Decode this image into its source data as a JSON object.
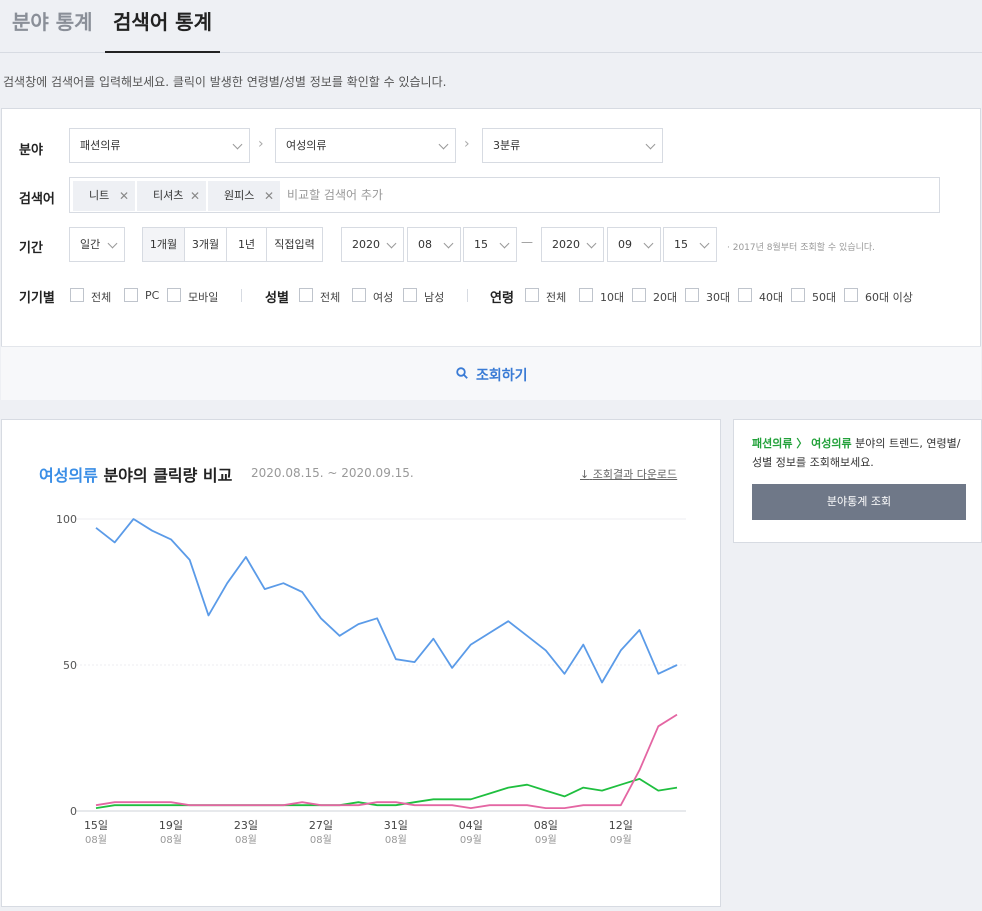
{
  "tabs": {
    "field": "분야 통계",
    "keyword": "검색어 통계"
  },
  "help_text": "검색창에 검색어를 입력해보세요. 클릭이 발생한 연령별/성별 정보를 확인할 수 있습니다.",
  "filters": {
    "category_label": "분야",
    "cat1": "패션의류",
    "cat2": "여성의류",
    "cat3": "3분류",
    "keyword_label": "검색어",
    "keywords": [
      "니트",
      "티셔츠",
      "원피스"
    ],
    "keyword_placeholder": "비교할 검색어 추가",
    "period_label": "기간",
    "granularity": "일간",
    "ranges": [
      "1개월",
      "3개월",
      "1년",
      "직접입력"
    ],
    "start": {
      "year": "2020",
      "month": "08",
      "day": "15"
    },
    "end": {
      "year": "2020",
      "month": "09",
      "day": "15"
    },
    "date_note": "· 2017년 8월부터 조회할 수 있습니다.",
    "device_label": "기기별",
    "devices": [
      "전체",
      "PC",
      "모바일"
    ],
    "gender_label": "성별",
    "genders": [
      "전체",
      "여성",
      "남성"
    ],
    "age_label": "연령",
    "ages": [
      "전체",
      "10대",
      "20대",
      "30대",
      "40대",
      "50대",
      "60대 이상"
    ],
    "range_dash": "—",
    "search_button": "조회하기"
  },
  "chart_header": {
    "title_accent": "여성의류",
    "title_rest": " 분야의 클릭량 비교",
    "range": "2020.08.15. ~ 2020.09.15.",
    "download": "조회결과 다운로드"
  },
  "side_panel": {
    "path_cat1": "패션의류",
    "path_sep": " 〉 ",
    "path_cat2": "여성의류",
    "text_rest": " 분야의 트렌드, 연령별/성별 정보를 조회해보세요.",
    "button": "분야통계 조회"
  },
  "colors": {
    "accent": "#3a8ee6",
    "green": "#22a13a",
    "blue_series": "#5b9be8",
    "green_series": "#1fbf3f",
    "pink_series": "#e466a3"
  },
  "chart_data": {
    "type": "line",
    "ylim": [
      0,
      100
    ],
    "yticks": [
      "100",
      "50",
      "0"
    ],
    "xticks": [
      {
        "day": "15일",
        "month": "08월"
      },
      {
        "day": "19일",
        "month": "08월"
      },
      {
        "day": "23일",
        "month": "08월"
      },
      {
        "day": "27일",
        "month": "08월"
      },
      {
        "day": "31일",
        "month": "08월"
      },
      {
        "day": "04일",
        "month": "09월"
      },
      {
        "day": "08일",
        "month": "09월"
      },
      {
        "day": "12일",
        "month": "09월"
      }
    ],
    "series": [
      {
        "color": "#5b9be8",
        "values": [
          97,
          92,
          100,
          96,
          93,
          86,
          67,
          78,
          87,
          76,
          78,
          75,
          66,
          60,
          64,
          66,
          52,
          51,
          59,
          49,
          57,
          61,
          65,
          60,
          55,
          47,
          57,
          44,
          55,
          62,
          47,
          50
        ]
      },
      {
        "color": "#1fbf3f",
        "values": [
          1,
          2,
          2,
          2,
          2,
          2,
          2,
          2,
          2,
          2,
          2,
          2,
          2,
          2,
          3,
          2,
          2,
          3,
          4,
          4,
          4,
          6,
          8,
          9,
          7,
          5,
          8,
          7,
          9,
          11,
          7,
          8
        ]
      },
      {
        "color": "#e466a3",
        "values": [
          2,
          3,
          3,
          3,
          3,
          2,
          2,
          2,
          2,
          2,
          2,
          3,
          2,
          2,
          2,
          3,
          3,
          2,
          2,
          2,
          1,
          2,
          2,
          2,
          1,
          1,
          2,
          2,
          2,
          14,
          29,
          33
        ]
      }
    ]
  }
}
